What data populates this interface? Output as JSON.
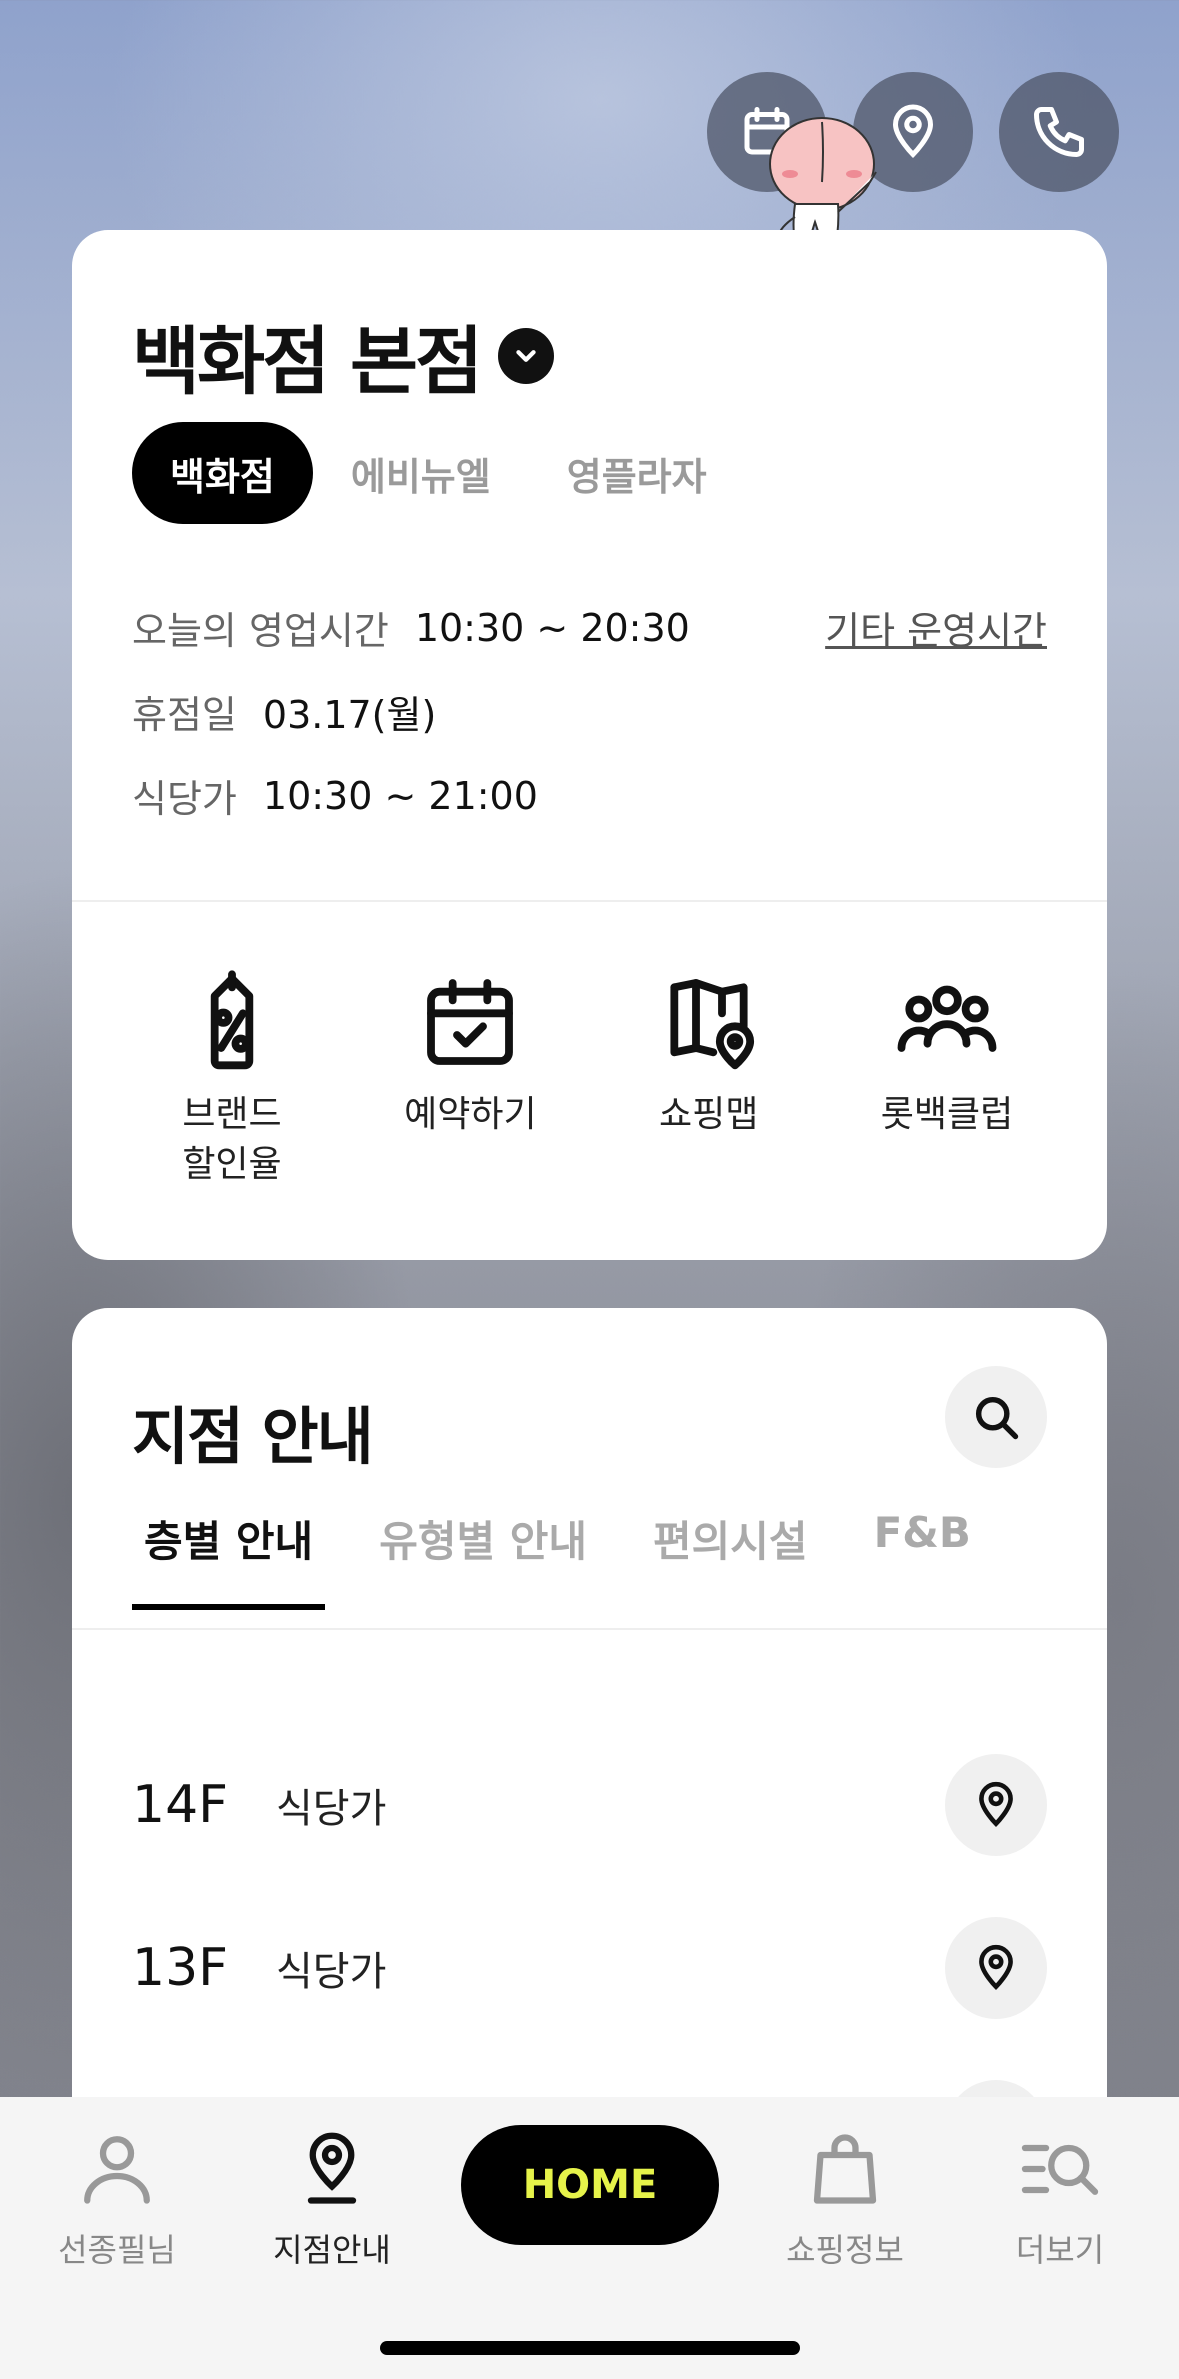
{
  "top_actions": [
    {
      "icon": "calendar-icon"
    },
    {
      "icon": "location-pin-icon"
    },
    {
      "icon": "phone-icon"
    }
  ],
  "store": {
    "name": "백화점 본점",
    "tabs": [
      {
        "label": "백화점",
        "active": true
      },
      {
        "label": "에비뉴엘",
        "active": false
      },
      {
        "label": "영플라자",
        "active": false
      }
    ],
    "hours_label": "오늘의 영업시간",
    "hours_value": "10:30 ~ 20:30",
    "other_hours": "기타 운영시간",
    "closed_label": "휴점일",
    "closed_value": "03.17(월)",
    "dining_label": "식당가",
    "dining_value": "10:30 ~ 21:00"
  },
  "quick_menu": [
    {
      "label": "브랜드\n할인율",
      "icon": "discount-tag-icon"
    },
    {
      "label": "예약하기",
      "icon": "calendar-check-icon"
    },
    {
      "label": "쇼핑맵",
      "icon": "map-pin-icon"
    },
    {
      "label": "롯백클럽",
      "icon": "group-icon"
    }
  ],
  "branch": {
    "title": "지점 안내",
    "tabs": [
      {
        "label": "층별 안내",
        "active": true
      },
      {
        "label": "유형별 안내",
        "active": false
      },
      {
        "label": "편의시설",
        "active": false
      },
      {
        "label": "F&B",
        "active": false
      }
    ],
    "floors": [
      {
        "floor": "14F",
        "name": "식당가"
      },
      {
        "floor": "13F",
        "name": "식당가"
      }
    ]
  },
  "bottom_nav": {
    "items": [
      {
        "label": "선종필님",
        "icon": "person-icon"
      },
      {
        "label": "지점안내",
        "icon": "store-pin-icon"
      },
      {
        "label": "쇼핑정보",
        "icon": "shopping-bag-icon"
      },
      {
        "label": "더보기",
        "icon": "more-search-icon"
      }
    ],
    "home_label": "HOME"
  }
}
